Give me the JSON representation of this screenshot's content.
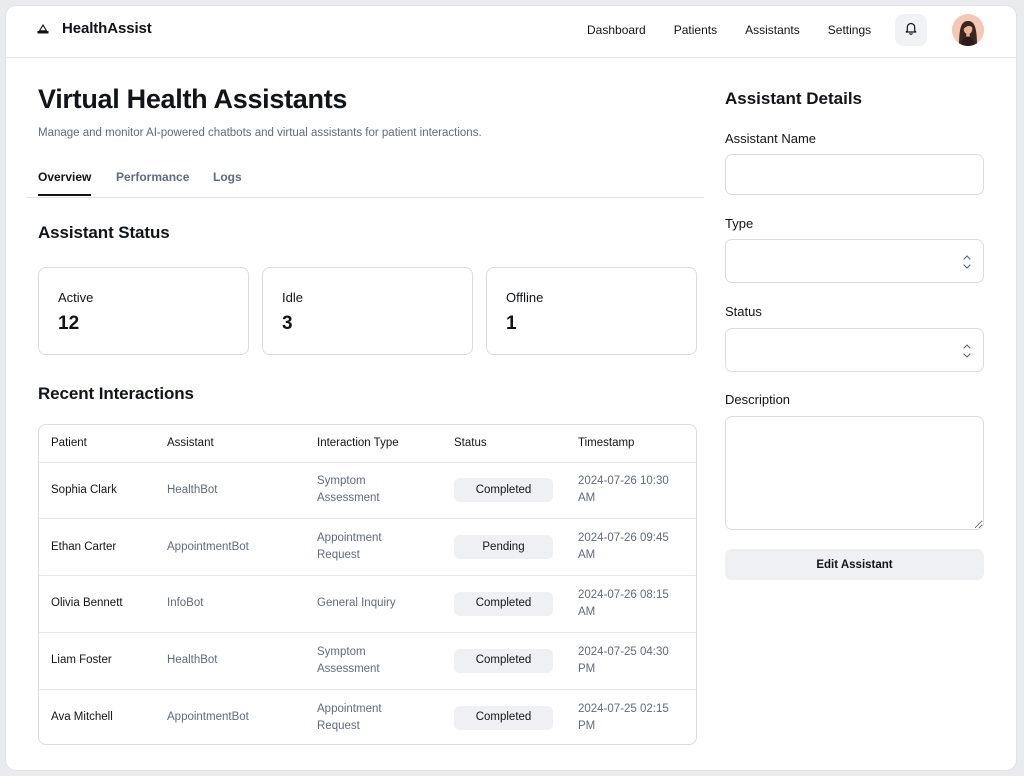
{
  "brand": {
    "name": "HealthAssist"
  },
  "nav": {
    "items": [
      "Dashboard",
      "Patients",
      "Assistants",
      "Settings"
    ]
  },
  "page": {
    "title": "Virtual Health Assistants",
    "subtitle": "Manage and monitor AI-powered chatbots and virtual assistants for patient interactions."
  },
  "tabs": [
    {
      "label": "Overview",
      "active": true
    },
    {
      "label": "Performance",
      "active": false
    },
    {
      "label": "Logs",
      "active": false
    }
  ],
  "status": {
    "title": "Assistant Status",
    "cards": [
      {
        "label": "Active",
        "value": "12"
      },
      {
        "label": "Idle",
        "value": "3"
      },
      {
        "label": "Offline",
        "value": "1"
      }
    ]
  },
  "interactions": {
    "title": "Recent Interactions",
    "columns": [
      "Patient",
      "Assistant",
      "Interaction Type",
      "Status",
      "Timestamp"
    ],
    "rows": [
      [
        "Sophia Clark",
        "HealthBot",
        "Symptom Assessment",
        "Completed",
        "2024-07-26 10:30 AM"
      ],
      [
        "Ethan Carter",
        "AppointmentBot",
        "Appointment Request",
        "Pending",
        "2024-07-26 09:45 AM"
      ],
      [
        "Olivia Bennett",
        "InfoBot",
        "General Inquiry",
        "Completed",
        "2024-07-26 08:15 AM"
      ],
      [
        "Liam Foster",
        "HealthBot",
        "Symptom Assessment",
        "Completed",
        "2024-07-25 04:30 PM"
      ],
      [
        "Ava Mitchell",
        "AppointmentBot",
        "Appointment Request",
        "Completed",
        "2024-07-25 02:15 PM"
      ]
    ]
  },
  "details": {
    "title": "Assistant Details",
    "name_label": "Assistant Name",
    "name_value": "",
    "type_label": "Type",
    "type_value": "",
    "status_label": "Status",
    "status_value": "",
    "description_label": "Description",
    "description_value": "",
    "edit_label": "Edit Assistant"
  },
  "colors": {
    "muted_text": "#5e6b7e",
    "pill_bg": "#eef0f3",
    "border": "#d9dde3"
  },
  "icons": {
    "logo": "triangle-logo-icon",
    "notifications": "bell-icon",
    "select": "chevron-up-down-icon"
  }
}
